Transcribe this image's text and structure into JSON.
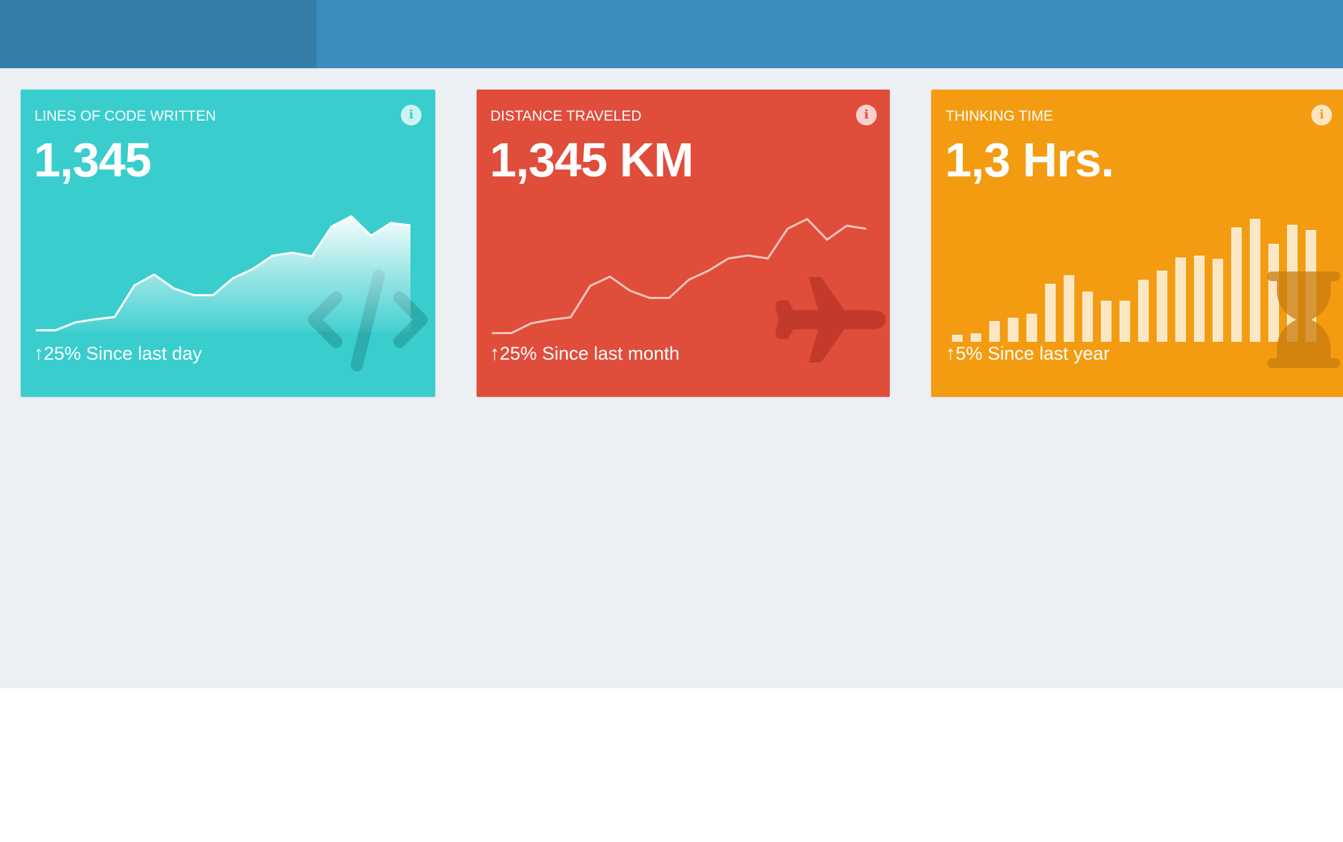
{
  "colors": {
    "topbar": "#3b8ebf",
    "topbar_brand": "#357ea9",
    "content_bg": "#eceff3",
    "teal": "#3acdce",
    "red": "#e04d3b",
    "orange": "#f39c12"
  },
  "cards": [
    {
      "id": "code",
      "title": "LINES OF CODE WRITTEN",
      "value": "1,345",
      "trend_arrow": "↑",
      "trend_text": "25% Since last day",
      "bg_icon": "code-icon",
      "info_icon": "info-icon",
      "chart_type": "area",
      "series": [
        3,
        3,
        16,
        21,
        25,
        77,
        95,
        72,
        61,
        61,
        89,
        104,
        126,
        131,
        125,
        174,
        191,
        159,
        180,
        176
      ]
    },
    {
      "id": "distance",
      "title": "DISTANCE TRAVELED",
      "value": "1,345 KM",
      "trend_arrow": "↑",
      "trend_text": "25% Since last month",
      "bg_icon": "plane-icon",
      "info_icon": "info-icon",
      "chart_type": "line",
      "series": [
        3,
        3,
        19,
        25,
        29,
        81,
        96,
        73,
        61,
        61,
        91,
        106,
        126,
        131,
        126,
        175,
        191,
        157,
        180,
        175
      ]
    },
    {
      "id": "thinking",
      "title": "THINKING TIME",
      "value": "1,3 Hrs.",
      "trend_arrow": "↑",
      "trend_text": "5% Since last year",
      "bg_icon": "hourglass-icon",
      "info_icon": "info-icon",
      "chart_type": "bar",
      "series": [
        10,
        12,
        31,
        36,
        42,
        88,
        101,
        76,
        62,
        62,
        94,
        108,
        128,
        131,
        126,
        174,
        187,
        149,
        178,
        170
      ]
    }
  ]
}
